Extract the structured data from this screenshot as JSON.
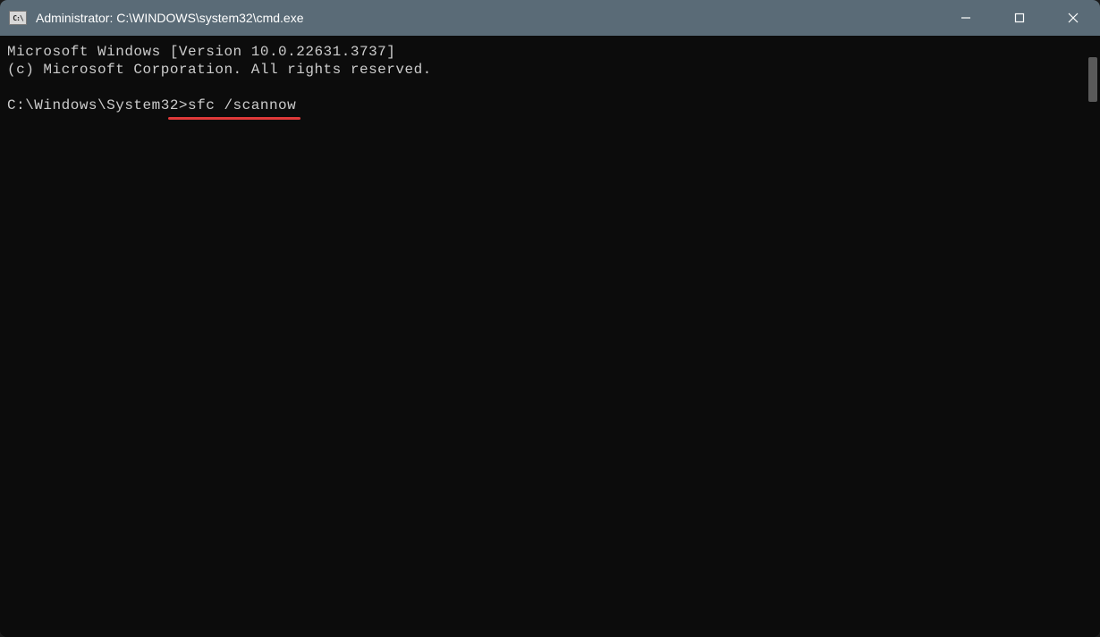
{
  "window": {
    "icon_label": "C:\\",
    "title": "Administrator: C:\\WINDOWS\\system32\\cmd.exe"
  },
  "terminal": {
    "line1": "Microsoft Windows [Version 10.0.22631.3737]",
    "line2": "(c) Microsoft Corporation. All rights reserved.",
    "prompt": "C:\\Windows\\System32>",
    "command": "sfc /scannow"
  },
  "annotation": {
    "underline_color": "#e03a3a"
  }
}
